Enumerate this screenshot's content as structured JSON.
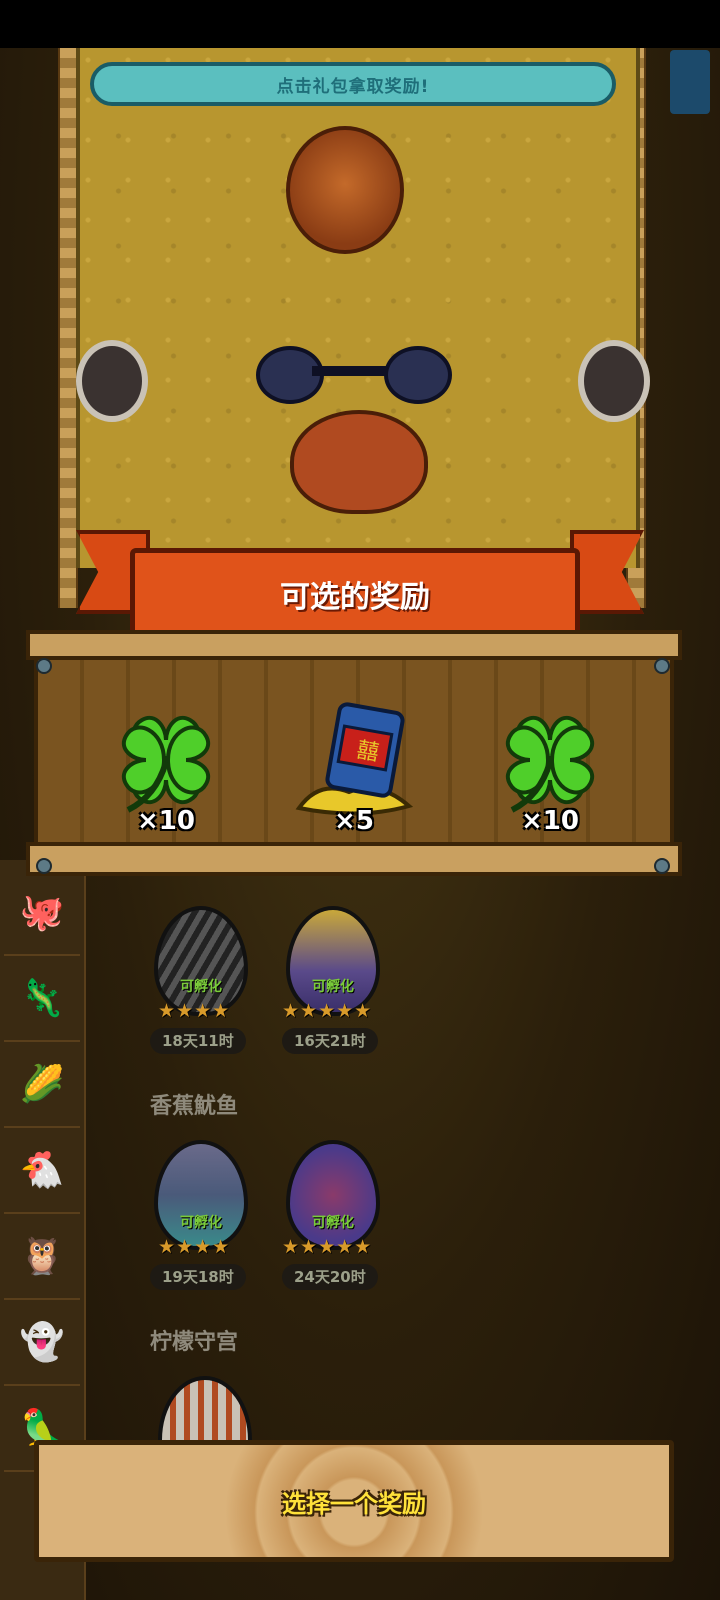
{
  "top_banner": {
    "text": "点击礼包拿取奖励!"
  },
  "ribbon": {
    "title": "可选的奖励"
  },
  "rewards": [
    {
      "icon": "four-leaf-clover-icon",
      "qty": "×10"
    },
    {
      "icon": "lantern-lamp-icon",
      "qty": "×5"
    },
    {
      "icon": "four-leaf-clover-icon",
      "qty": "×10"
    }
  ],
  "eggs_row1": [
    {
      "status": "可孵化",
      "stars": "★★★★",
      "timer": "18天11时"
    },
    {
      "status": "可孵化",
      "stars": "★★★★★",
      "timer": "16天21时"
    }
  ],
  "section2": {
    "title": "香蕉魷鱼"
  },
  "eggs_row2": [
    {
      "status": "可孵化",
      "stars": "★★★★",
      "timer": "19天18时"
    },
    {
      "status": "可孵化",
      "stars": "★★★★★",
      "timer": "24天20时"
    }
  ],
  "section3": {
    "title": "柠檬守宫"
  },
  "select_button": {
    "label": "选择一个奖励"
  },
  "colors": {
    "ribbon": "#e0531a",
    "banner": "#5bbfbf",
    "button_text": "#ffe23a"
  }
}
